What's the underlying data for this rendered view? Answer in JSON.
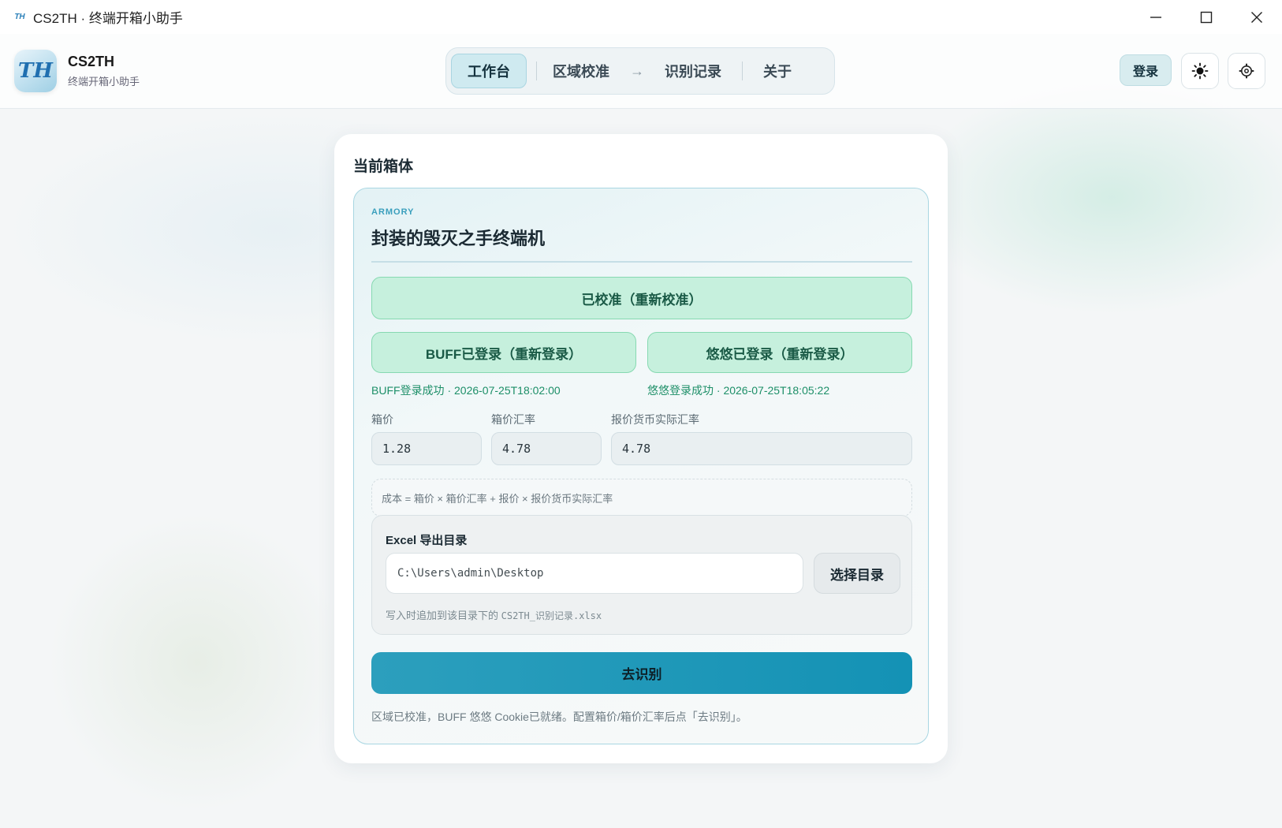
{
  "window": {
    "title": "CS2TH · 终端开箱小助手",
    "controls": [
      "minimize",
      "maximize",
      "close"
    ]
  },
  "header": {
    "brand_name": "CS2TH",
    "brand_subtitle": "终端开箱小助手",
    "nav": {
      "items": [
        {
          "label": "工作台",
          "active": true
        },
        {
          "label": "区域校准",
          "active": false
        },
        {
          "label": "→",
          "active": false
        },
        {
          "label": "识别记录",
          "active": false
        },
        {
          "label": "关于",
          "active": false
        }
      ]
    },
    "login_label": "登录",
    "icons": {
      "theme": "sun-icon",
      "settings": "gear-icon"
    }
  },
  "card": {
    "title": "当前箱体",
    "tag": "ARMORY",
    "case_name": "封装的毁灭之手终端机",
    "calibrate_button": "已校准（重新校准）",
    "buff_button": "BUFF已登录（重新登录）",
    "youyou_button": "悠悠已登录（重新登录）",
    "buff_status": "BUFF登录成功 · 2026-07-25T18:02:00",
    "youyou_status": "悠悠登录成功 · 2026-07-25T18:05:22",
    "fields": {
      "box_price_label": "箱价",
      "box_price_value": "1.28",
      "box_rate_label": "箱价汇率",
      "box_rate_value": "4.78",
      "quote_rate_label": "报价货币实际汇率",
      "quote_rate_value": "4.78"
    },
    "formula": "成本 = 箱价 × 箱价汇率 + 报价 × 报价货币实际汇率",
    "excel": {
      "title": "Excel 导出目录",
      "path": "C:\\Users\\admin\\Desktop",
      "choose_button": "选择目录",
      "hint_prefix": "写入时追加到该目录下的 ",
      "hint_file": "CS2TH_识别记录.xlsx"
    },
    "go_button": "去识别",
    "footer_note": "区域已校准，BUFF 悠悠 Cookie已就绪。配置箱价/箱价汇率后点「去识别」。"
  },
  "colors": {
    "accent": "#1492b5",
    "success_bg": "#c6f0dd",
    "success_text": "#1d8f68"
  }
}
